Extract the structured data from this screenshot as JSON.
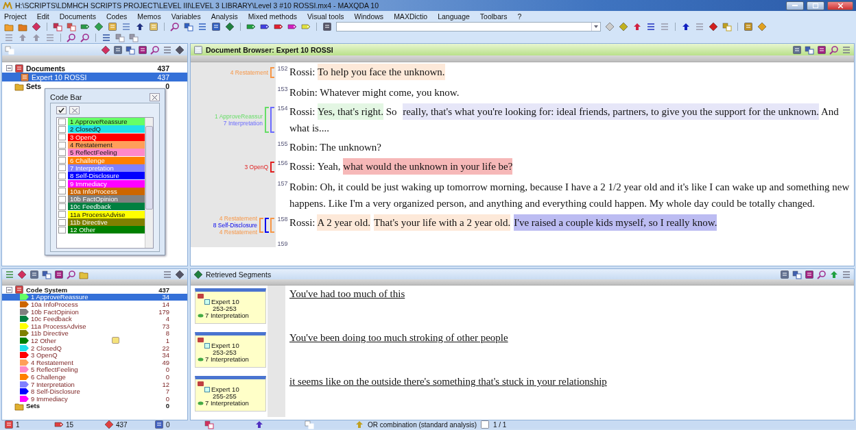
{
  "window": {
    "title": "H:\\SCRIPTS\\LDMHCH SCRIPTS PROJECT\\LEVEL III\\LEVEL 3 LIBRARY\\Level 3 #10 ROSSI.mx4 - MAXQDA 10"
  },
  "menu": [
    "Project",
    "Edit",
    "Documents",
    "Codes",
    "Memos",
    "Variables",
    "Analysis",
    "Mixed methods",
    "Visual tools",
    "Windows",
    "MAXDictio",
    "Language",
    "Toolbars",
    "?"
  ],
  "documents": {
    "tree": [
      {
        "label": "Documents",
        "count": "437",
        "expanded": true,
        "selected": false,
        "children": [
          {
            "label": "Expert 10 ROSSI",
            "count": "437",
            "expanded": false,
            "selected": true
          }
        ]
      },
      {
        "label": "Sets",
        "count": "0",
        "expanded": false,
        "selected": false
      }
    ]
  },
  "code_bar": {
    "title": "Code Bar",
    "items": [
      {
        "label": "1 ApproveReassure",
        "color": "#66ff66",
        "checked": false
      },
      {
        "label": "2 ClosedQ",
        "color": "#22e0e8",
        "checked": false
      },
      {
        "label": "3 OpenQ",
        "color": "#ff0000",
        "checked": false
      },
      {
        "label": "4 Restatement",
        "color": "#ff9f5a",
        "checked": false
      },
      {
        "label": "5 ReflectFeeling",
        "color": "#ff88c8",
        "checked": false
      },
      {
        "label": "6 Challenge",
        "color": "#ff8000",
        "checked": false
      },
      {
        "label": "7 Interpretation",
        "color": "#8080ff",
        "checked": false
      },
      {
        "label": "8 Self-Disclosure",
        "color": "#0000ff",
        "checked": false
      },
      {
        "label": "9 Immediacy",
        "color": "#ff00ff",
        "checked": false
      },
      {
        "label": "10a InfoProcess",
        "color": "#cc6600",
        "checked": false
      },
      {
        "label": "10b FactOpinion",
        "color": "#808080",
        "checked": false
      },
      {
        "label": "10c Feedback",
        "color": "#008040",
        "checked": false
      },
      {
        "label": "11a ProcessAdvise",
        "color": "#ffff00",
        "checked": false
      },
      {
        "label": "11b Directive",
        "color": "#808000",
        "checked": false
      },
      {
        "label": "12 Other",
        "color": "#008000",
        "checked": false
      }
    ]
  },
  "document_browser": {
    "title": "Document Browser: Expert 10 ROSSI",
    "paragraphs": [
      {
        "number": "152",
        "codes": [
          {
            "label": "4 Restatement",
            "color": "#f79646"
          }
        ],
        "segments": [
          {
            "text": "Rossi: "
          },
          {
            "text": "To help you face the unknown.",
            "color": "#fde9d9"
          }
        ]
      },
      {
        "number": "153",
        "segments": [
          {
            "text": "Robin: Whatever might come, you know."
          }
        ]
      },
      {
        "number": "154",
        "codes": [
          {
            "label": "1 ApproveReassur",
            "color": "#66dd66"
          },
          {
            "label": "7 Interpretation",
            "color": "#6a6aff"
          }
        ],
        "segments": [
          {
            "text": "Rossi: "
          },
          {
            "text": "Yes, that's right.",
            "color": "#e3f6e3"
          },
          {
            "text": " So "
          },
          {
            "text": "really, that's what you're looking for: ideal friends, partners, to give you the support for the unknown.",
            "color": "#e6e6f8"
          },
          {
            "text": " And what is...."
          }
        ]
      },
      {
        "number": "155",
        "segments": [
          {
            "text": "Robin: The unknown?"
          }
        ]
      },
      {
        "number": "156",
        "codes": [
          {
            "label": "3 OpenQ",
            "color": "#e02020"
          }
        ],
        "segments": [
          {
            "text": "Rossi: Yeah, "
          },
          {
            "text": "what would the unknown in your life be?",
            "color": "#f6b8b8"
          }
        ]
      },
      {
        "number": "157",
        "segments": [
          {
            "text": "Robin: Oh, it could be just waking up tomorrow morning, because I have a 2 1/2 year old and it's like I can wake up and something new happens. Like I'm a very organized person, and anything and everything could happen. My whole day could be totally changed."
          }
        ]
      },
      {
        "number": "158",
        "codes": [
          {
            "label": "4 Restatement",
            "color": "#f79646"
          },
          {
            "label": "8 Self-Disclosure",
            "color": "#0000ee"
          },
          {
            "label": "4 Restatement",
            "color": "#f79646"
          }
        ],
        "segments": [
          {
            "text": "Rossi: "
          },
          {
            "text": "A 2 year old.",
            "color": "#fde9d9"
          },
          {
            "text": "That's your life with a 2 year old.",
            "color": "#fde9d9"
          },
          {
            "text": "I've raised a couple kids myself, so I really know.",
            "color": "#bcbcf2"
          }
        ]
      },
      {
        "number": "159"
      }
    ]
  },
  "code_system": {
    "tree": [
      {
        "label": "Code System",
        "count": "437",
        "expanded": true,
        "selected": false,
        "children": [
          {
            "label": "1 ApproveReassure",
            "count": "34",
            "color": "#66ff66",
            "selected": true,
            "memo": false
          },
          {
            "label": "10a InfoProcess",
            "count": "14",
            "color": "#cc6600",
            "selected": false,
            "memo": false
          },
          {
            "label": "10b FactOpinion",
            "count": "179",
            "color": "#808080",
            "selected": false,
            "memo": false
          },
          {
            "label": "10c Feedback",
            "count": "4",
            "color": "#008040",
            "selected": false,
            "memo": false
          },
          {
            "label": "11a ProcessAdvise",
            "count": "73",
            "color": "#ffff00",
            "selected": false,
            "memo": false
          },
          {
            "label": "11b Directive",
            "count": "8",
            "color": "#808000",
            "selected": false,
            "memo": false
          },
          {
            "label": "12 Other",
            "count": "1",
            "color": "#008000",
            "selected": false,
            "memo": true
          },
          {
            "label": "2 ClosedQ",
            "count": "22",
            "color": "#22e0e8",
            "selected": false,
            "memo": false
          },
          {
            "label": "3 OpenQ",
            "count": "34",
            "color": "#ff0000",
            "selected": false,
            "memo": false
          },
          {
            "label": "4 Restatement",
            "count": "49",
            "color": "#ff9f5a",
            "selected": false,
            "memo": false
          },
          {
            "label": "5 ReflectFeeling",
            "count": "0",
            "color": "#ff88c8",
            "selected": false,
            "memo": false
          },
          {
            "label": "6 Challenge",
            "count": "0",
            "color": "#ff8000",
            "selected": false,
            "memo": false
          },
          {
            "label": "7 Interpretation",
            "count": "12",
            "color": "#8080ff",
            "selected": false,
            "memo": false
          },
          {
            "label": "8 Self-Disclosure",
            "count": "7",
            "color": "#0000ff",
            "selected": false,
            "memo": false
          },
          {
            "label": "9 Immediacy",
            "count": "0",
            "color": "#ff00ff",
            "selected": false,
            "memo": false
          }
        ]
      },
      {
        "label": "Sets",
        "count": "0",
        "expanded": false,
        "selected": false
      }
    ]
  },
  "retrieved_segments": {
    "title": "Retrieved Segments",
    "items": [
      {
        "document": "Expert 10",
        "range": "253-253",
        "code": "7 Interpretation",
        "text": "You've had too much of this"
      },
      {
        "document": "Expert 10",
        "range": "253-253",
        "code": "7 Interpretation",
        "text": "You've been doing too much stroking of other people"
      },
      {
        "document": "Expert 10",
        "range": "255-255",
        "code": "7 Interpretation",
        "text": "it seems like on the outside there's something that's stuck in your relationship"
      }
    ]
  },
  "status_bar": {
    "documents": "1",
    "codes": "15",
    "segments": "437",
    "memos": "0",
    "mode": "OR combination (standard analysis)",
    "pages": "1 / 1"
  }
}
